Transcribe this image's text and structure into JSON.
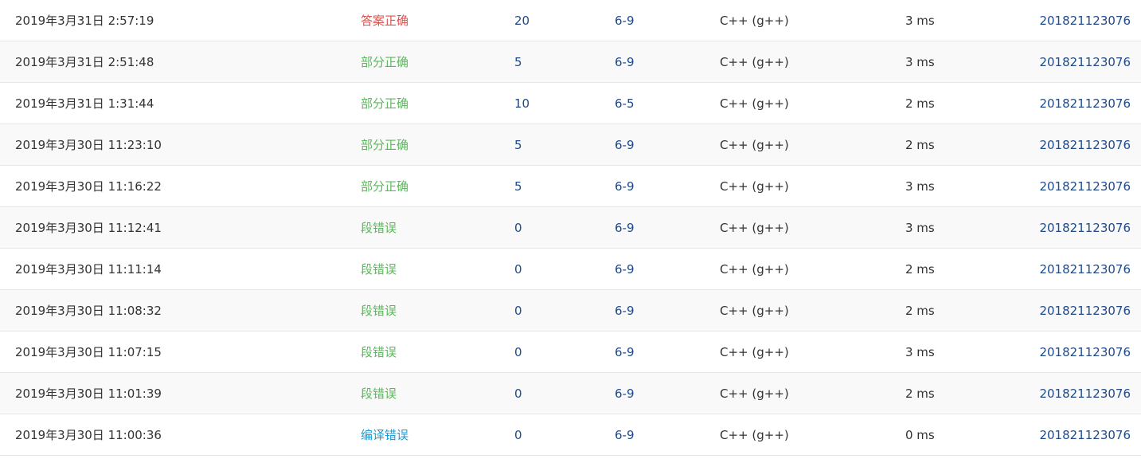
{
  "submissions": [
    {
      "time": "2019年3月31日 2:57:19",
      "status": "答案正确",
      "status_color": "red",
      "score": "20",
      "problem": "6-9",
      "compiler": "C++ (g++)",
      "memory": "3 ms",
      "user": "201821123076"
    },
    {
      "time": "2019年3月31日 2:51:48",
      "status": "部分正确",
      "status_color": "green",
      "score": "5",
      "problem": "6-9",
      "compiler": "C++ (g++)",
      "memory": "3 ms",
      "user": "201821123076"
    },
    {
      "time": "2019年3月31日 1:31:44",
      "status": "部分正确",
      "status_color": "green",
      "score": "10",
      "problem": "6-5",
      "compiler": "C++ (g++)",
      "memory": "2 ms",
      "user": "201821123076"
    },
    {
      "time": "2019年3月30日 11:23:10",
      "status": "部分正确",
      "status_color": "green",
      "score": "5",
      "problem": "6-9",
      "compiler": "C++ (g++)",
      "memory": "2 ms",
      "user": "201821123076"
    },
    {
      "time": "2019年3月30日 11:16:22",
      "status": "部分正确",
      "status_color": "green",
      "score": "5",
      "problem": "6-9",
      "compiler": "C++ (g++)",
      "memory": "3 ms",
      "user": "201821123076"
    },
    {
      "time": "2019年3月30日 11:12:41",
      "status": "段错误",
      "status_color": "green",
      "score": "0",
      "problem": "6-9",
      "compiler": "C++ (g++)",
      "memory": "3 ms",
      "user": "201821123076"
    },
    {
      "time": "2019年3月30日 11:11:14",
      "status": "段错误",
      "status_color": "green",
      "score": "0",
      "problem": "6-9",
      "compiler": "C++ (g++)",
      "memory": "2 ms",
      "user": "201821123076"
    },
    {
      "time": "2019年3月30日 11:08:32",
      "status": "段错误",
      "status_color": "green",
      "score": "0",
      "problem": "6-9",
      "compiler": "C++ (g++)",
      "memory": "2 ms",
      "user": "201821123076"
    },
    {
      "time": "2019年3月30日 11:07:15",
      "status": "段错误",
      "status_color": "green",
      "score": "0",
      "problem": "6-9",
      "compiler": "C++ (g++)",
      "memory": "3 ms",
      "user": "201821123076"
    },
    {
      "time": "2019年3月30日 11:01:39",
      "status": "段错误",
      "status_color": "green",
      "score": "0",
      "problem": "6-9",
      "compiler": "C++ (g++)",
      "memory": "2 ms",
      "user": "201821123076"
    },
    {
      "time": "2019年3月30日 11:00:36",
      "status": "编译错误",
      "status_color": "blue",
      "score": "0",
      "problem": "6-9",
      "compiler": "C++ (g++)",
      "memory": "0 ms",
      "user": "201821123076"
    }
  ],
  "colors": {
    "red": "#d9534f",
    "green": "#5cb85c",
    "blue": "#1a9bd7",
    "link": "#1e4a8a"
  }
}
